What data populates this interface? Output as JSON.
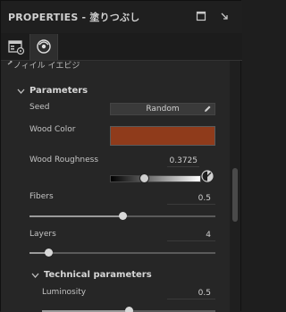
{
  "window": {
    "title": "PROPERTIES - 塗りつぶし"
  },
  "tabs": [
    {
      "icon": "texture-set-settings-icon",
      "active": false
    },
    {
      "icon": "fill-material-icon",
      "active": true
    }
  ],
  "partial_section": {
    "label": "ノィイル イエビジ"
  },
  "parameters": {
    "title": "Parameters",
    "seed": {
      "label": "Seed",
      "button_label": "Random"
    },
    "wood_color": {
      "label": "Wood Color",
      "color": "#8f3b1b"
    },
    "wood_roughness": {
      "label": "Wood Roughness",
      "value": "0.3725",
      "level": 0.3725
    },
    "fibers": {
      "label": "Fibers",
      "value": "0.5",
      "level": 0.5
    },
    "layers": {
      "label": "Layers",
      "value": "4",
      "level": 0.1
    },
    "technical": {
      "title": "Technical parameters",
      "luminosity": {
        "label": "Luminosity",
        "value": "0.5",
        "level": 0.5
      }
    }
  }
}
